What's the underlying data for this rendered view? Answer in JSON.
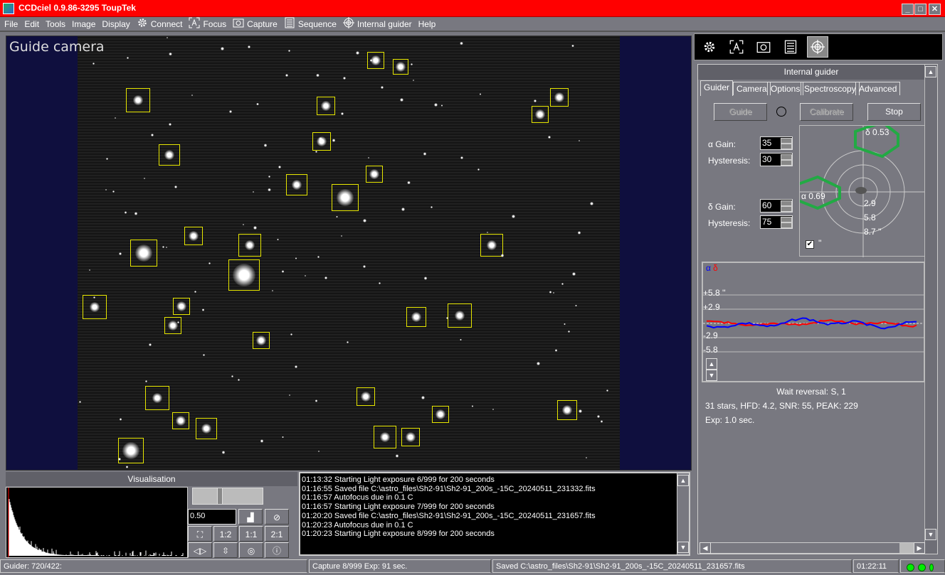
{
  "window": {
    "title": "CCDciel 0.9.86-3295 ToupTek",
    "minimize": "_",
    "maximize": "□",
    "close": "✕"
  },
  "menu": [
    {
      "label": "File"
    },
    {
      "label": "Edit"
    },
    {
      "label": "Tools"
    },
    {
      "label": "Image"
    },
    {
      "label": "Display"
    },
    {
      "label": "Connect",
      "icon": "gear-icon"
    },
    {
      "label": "Focus",
      "icon": "focus-icon"
    },
    {
      "label": "Capture",
      "icon": "camera-icon"
    },
    {
      "label": "Sequence",
      "icon": "list-icon"
    },
    {
      "label": "Internal guider",
      "icon": "crosshair-icon"
    },
    {
      "label": "Help"
    }
  ],
  "image": {
    "title": "Guide camera"
  },
  "right_toolbar": [
    "gear-icon",
    "focus-icon",
    "camera-icon",
    "list-icon",
    "crosshair-icon"
  ],
  "guider": {
    "header": "Internal guider",
    "tabs": [
      "Guider",
      "Camera",
      "Options",
      "Spectroscopy",
      "Advanced"
    ],
    "active_tab": "Guider",
    "buttons": {
      "guide": "Guide",
      "calibrate": "Calibrate",
      "stop": "Stop"
    },
    "alpha_gain_label": "α Gain:",
    "alpha_gain": "35",
    "alpha_hyst_label": "Hysteresis:",
    "alpha_hyst": "30",
    "delta_gain_label": "δ Gain:",
    "delta_gain": "60",
    "delta_hyst_label": "Hysteresis:",
    "delta_hyst": "75",
    "target": {
      "delta_rms": "δ  0.53",
      "alpha_rms": "α  0.69",
      "rings": [
        "2.9",
        "5.8",
        "8.7 ''"
      ],
      "checkbox_label": "''",
      "checked": true
    },
    "graph": {
      "legend_alpha": "α",
      "legend_delta": "δ",
      "ticks": [
        "+5.8 ''",
        "+2.9",
        "-2.9",
        "-5.8"
      ],
      "alpha_color": "#0000ff",
      "delta_color": "#ff0000"
    },
    "wait_reversal": "Wait reversal: S, 1",
    "stats": "31 stars, HFD: 4.2, SNR: 55, PEAK: 229",
    "exposure": "Exp: 1.0 sec."
  },
  "visualisation": {
    "title": "Visualisation",
    "gamma": "0.50",
    "zoom_buttons": [
      "1:2",
      "1:1",
      "2:1"
    ]
  },
  "log": [
    "01:13:32 Starting Light exposure 6/999 for 200 seconds",
    "01:16:55 Saved file C:\\astro_files\\Sh2-91\\Sh2-91_200s_-15C_20240511_231332.fits",
    "01:16:57 Autofocus due in  0.1 C",
    "01:16:57 Starting Light exposure 7/999 for 200 seconds",
    "01:20:20 Saved file C:\\astro_files\\Sh2-91\\Sh2-91_200s_-15C_20240511_231657.fits",
    "01:20:23 Autofocus due in  0.1 C",
    "01:20:23 Starting Light exposure 8/999 for 200 seconds"
  ],
  "status": {
    "guider": "Guider: 720/422:",
    "capture": "Capture 8/999 Exp: 91 sec.",
    "saved": "Saved C:\\astro_files\\Sh2-91\\Sh2-91_200s_-15C_20240511_231657.fits",
    "clock": "01:22:11"
  },
  "colors": {
    "titlebar": "#ff0000",
    "star_box": "#e6e600",
    "annotation": "#22aa44",
    "led": "#00ee00"
  }
}
